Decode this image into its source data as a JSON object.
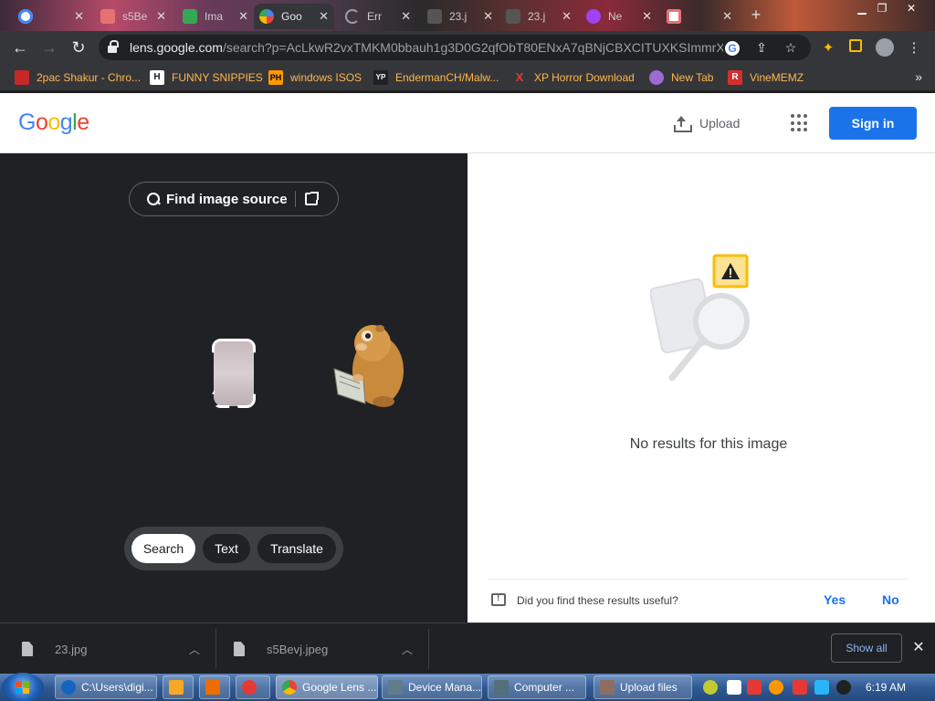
{
  "browser": {
    "tabs": [
      {
        "title": "",
        "favicon_color": "#fbbc05"
      },
      {
        "title": "s5Be",
        "favicon_color": "#e57373"
      },
      {
        "title": "Ima",
        "favicon_color": "#34a853"
      },
      {
        "title": "Goo",
        "favicon_color": "#4285f4"
      },
      {
        "title": "Err",
        "favicon_color": "#9aa0a6"
      },
      {
        "title": "23.j",
        "favicon_color": "#999999"
      },
      {
        "title": "23.j",
        "favicon_color": "#999999"
      },
      {
        "title": "Ne",
        "favicon_color": "#a142f4"
      },
      {
        "title": "",
        "favicon_color": "#e57373"
      }
    ],
    "new_tab_glyph": "+",
    "address": {
      "host": "lens.google.com",
      "path": "/search?p=AcLkwR2vxTMKM0bbauh1g3D0G2qfObT80ENxA7qBNjCBXCITUXKSImmrX..."
    },
    "bookmarks": [
      {
        "label": "2pac Shakur - Chro...",
        "icon": "album-icon",
        "icon_bg": "#c62828",
        "icon_text": ""
      },
      {
        "label": "FUNNY SNIPPIES",
        "icon": "h-icon",
        "icon_bg": "#202124",
        "icon_text": "H"
      },
      {
        "label": "windows ISOS",
        "icon": "ph-icon",
        "icon_bg": "#ff9800",
        "icon_text": "PH"
      },
      {
        "label": "EndermanCH/Malw...",
        "icon": "yp-icon",
        "icon_bg": "#202124",
        "icon_text": "YP"
      },
      {
        "label": "XP Horror Download",
        "icon": "x-icon",
        "icon_bg": "#35363a",
        "icon_text": "X"
      },
      {
        "label": "New Tab",
        "icon": "globe-icon",
        "icon_bg": "#9c6ad0",
        "icon_text": ""
      },
      {
        "label": "VineMEMZ",
        "icon": "r-icon",
        "icon_bg": "#d32f2f",
        "icon_text": "R"
      }
    ],
    "more_glyph": "»"
  },
  "google": {
    "logo": [
      "G",
      "o",
      "o",
      "g",
      "l",
      "e"
    ],
    "logo_colors": [
      "#4285f4",
      "#ea4335",
      "#fbbc05",
      "#4285f4",
      "#34a853",
      "#ea4335"
    ],
    "upload_label": "Upload",
    "signin_label": "Sign in"
  },
  "lens": {
    "find_source_label": "Find image source",
    "modes": [
      "Search",
      "Text",
      "Translate"
    ],
    "active_mode": "Search",
    "no_results": "No results for this image",
    "feedback_question": "Did you find these results useful?",
    "feedback_yes": "Yes",
    "feedback_no": "No"
  },
  "downloads": {
    "items": [
      {
        "name": "23.jpg"
      },
      {
        "name": "s5Bevj.jpeg"
      }
    ],
    "show_all": "Show all",
    "close_glyph": "✕"
  },
  "taskbar": {
    "buttons": [
      {
        "label": "C:\\Users\\digi...",
        "icon_color": "#1565c0"
      },
      {
        "label": "",
        "icon_color": "#f9a825"
      },
      {
        "label": "",
        "icon_color": "#ef6c00"
      },
      {
        "label": "",
        "icon_color": "#e53935"
      },
      {
        "label": "Google Lens ...",
        "icon_color": "#4285f4"
      },
      {
        "label": "Device Mana...",
        "icon_color": "#607d8b"
      },
      {
        "label": "Computer ...",
        "icon_color": "#546e7a"
      },
      {
        "label": "Upload files",
        "icon_color": "#8d6e63"
      }
    ],
    "clock": "6:19 AM"
  }
}
